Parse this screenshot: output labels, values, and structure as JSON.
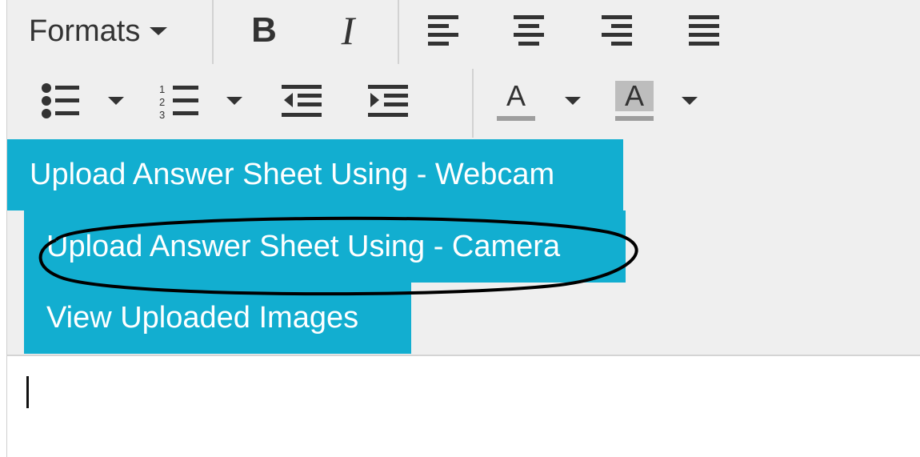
{
  "toolbar": {
    "formats_label": "Formats",
    "bold_label": "B",
    "italic_label": "I",
    "align_icons": [
      "align-left-icon",
      "align-center-icon",
      "align-right-icon",
      "align-justify-icon"
    ],
    "list_icons": [
      "bullet-list-icon",
      "numbered-list-icon",
      "outdent-icon",
      "indent-icon"
    ],
    "text_color_label": "A",
    "bg_color_label": "A"
  },
  "colors": {
    "menu_background": "#12aed0",
    "menu_text": "#ffffff",
    "toolbar_background": "#efefef",
    "annotation_ellipse": "#000000"
  },
  "menu": {
    "items": [
      {
        "label": "Upload Answer Sheet Using - Webcam"
      },
      {
        "label": "Upload Answer Sheet Using - Camera"
      },
      {
        "label": "View Uploaded Images"
      }
    ]
  }
}
